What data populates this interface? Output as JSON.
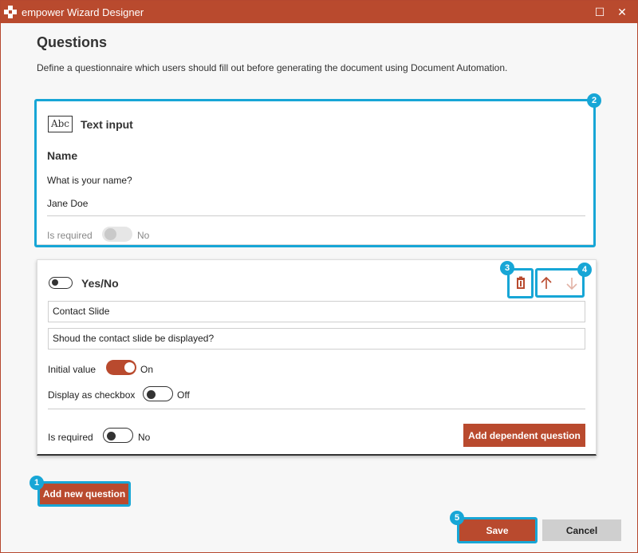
{
  "window": {
    "title": "empower Wizard Designer",
    "maximize_glyph": "☐",
    "close_glyph": "✕"
  },
  "page": {
    "title": "Questions",
    "description": "Define a questionnaire which users should fill out before generating the document using Document Automation."
  },
  "question1": {
    "type_icon_text": "Abc",
    "type_label": "Text input",
    "name": "Name",
    "prompt": "What is your name?",
    "value": "Jane Doe",
    "required_label": "Is required",
    "required_state": "No"
  },
  "question2": {
    "type_label": "Yes/No",
    "name_value": "Contact Slide",
    "prompt_value": "Shoud the contact slide be displayed?",
    "initial_label": "Initial value",
    "initial_state": "On",
    "checkbox_label": "Display as checkbox",
    "checkbox_state": "Off",
    "required_label": "Is required",
    "required_state": "No",
    "add_dependent_label": "Add dependent question"
  },
  "actions": {
    "add_new_label": "Add new question",
    "save_label": "Save",
    "cancel_label": "Cancel"
  },
  "callouts": [
    "1",
    "2",
    "3",
    "4",
    "5"
  ],
  "icons": {
    "app": "empower-logo-icon",
    "delete": "trash-icon",
    "move_up": "arrow-up-icon",
    "move_down": "arrow-down-icon",
    "text_type": "abc-text-icon",
    "yesno_type": "toggle-icon"
  },
  "colors": {
    "accent": "#b94a2e",
    "highlight": "#17a6d6",
    "disabled_arrow": "#e2b3a6"
  }
}
